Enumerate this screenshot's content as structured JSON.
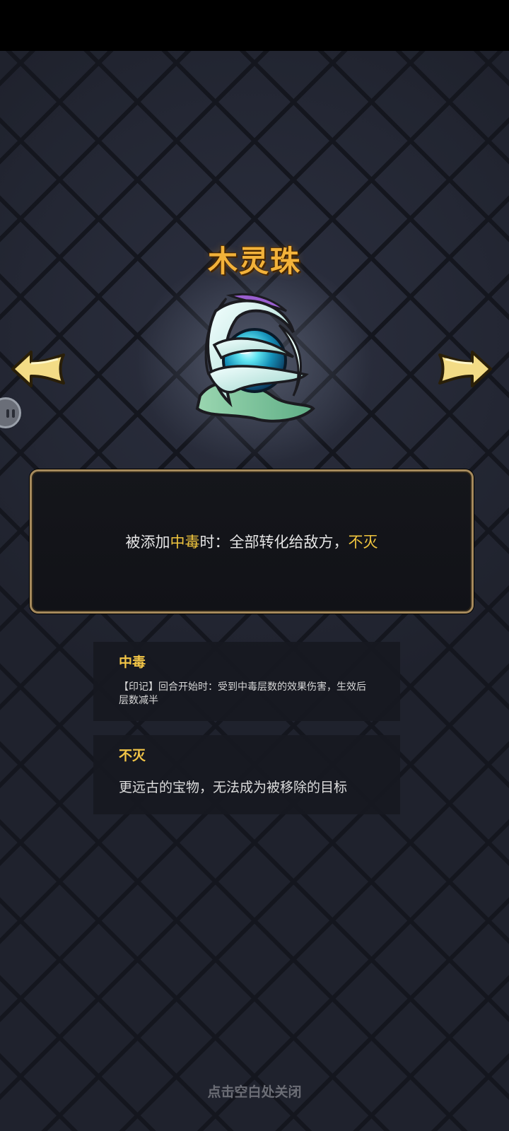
{
  "item": {
    "name": "木灵珠",
    "icon": "jade-spirit-orb-icon"
  },
  "description": {
    "prefix": "被添加",
    "highlight_1": "中毒",
    "middle": "时：全部转化给敌方，",
    "highlight_2": "不灭"
  },
  "keywords": [
    {
      "name": "中毒",
      "desc": "【印记】回合开始时：受到中毒层数的效果伤害，生效后层数减半"
    },
    {
      "name": "不灭",
      "desc": "更远古的宝物，无法成为被移除的目标"
    }
  ],
  "nav": {
    "prev_icon": "arrow-left-icon",
    "next_icon": "arrow-right-icon"
  },
  "close_hint": "点击空白处关闭",
  "colors": {
    "title": "#f2b23a",
    "highlight": "#f0c53e",
    "panel_border": "#a68a5c",
    "background": "#1e212c"
  }
}
